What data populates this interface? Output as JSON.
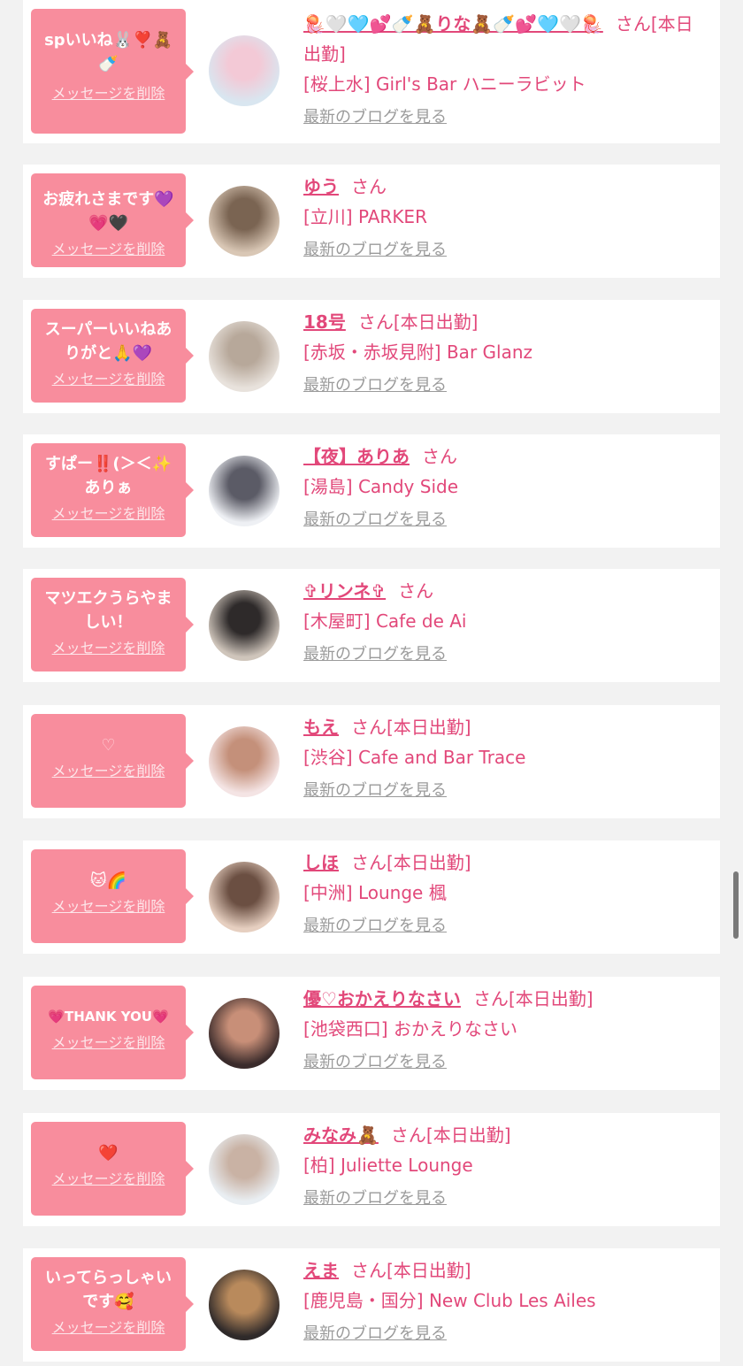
{
  "delete_label": "メッセージを削除",
  "blog_label": "最新のブログを見る",
  "san_label": "さん",
  "colors": {
    "bubble": "#f88d9d",
    "accent": "#e2487a",
    "link_gray": "#9b9b9b",
    "background": "#f2f2f2"
  },
  "items": [
    {
      "message": "spいいね🐰❣️🧸🍼",
      "name": "🪼🤍🩵💕🍼🧸りな🧸🍼💕🩵🤍🪼",
      "today": "[本日出勤]",
      "shop": "[桜上水] Girl's Bar ハニーラビット",
      "avatar_colors": [
        "#d9e6f0",
        "#f3c9d6"
      ]
    },
    {
      "message": "お疲れさまです💜💗🖤",
      "name": "ゆう",
      "today": "",
      "shop": "[立川] PARKER",
      "avatar_colors": [
        "#d9c7b5",
        "#7a6452"
      ]
    },
    {
      "message": "スーパーいいねありがと🙏💜",
      "name": "18号",
      "today": "[本日出勤]",
      "shop": "[赤坂・赤坂見附] Bar Glanz",
      "avatar_colors": [
        "#e8e2dc",
        "#b7a89a"
      ]
    },
    {
      "message": "すぱー‼️(＞＜✨ありぁ",
      "name": "【夜】ありあ",
      "today": "",
      "shop": "[湯島] Candy Side",
      "avatar_colors": [
        "#eef0f4",
        "#5b5b66"
      ]
    },
    {
      "message": "マツエクうらやましい！",
      "name": "✞リンネ✞",
      "today": "",
      "shop": "[木屋町] Cafe de Ai",
      "avatar_colors": [
        "#cfc5bb",
        "#2e2a2a"
      ]
    },
    {
      "message": "♡",
      "name": "もえ",
      "today": "[本日出勤]",
      "shop": "[渋谷] Cafe and Bar Trace",
      "avatar_colors": [
        "#f4e4e4",
        "#c4907a"
      ]
    },
    {
      "message": "🐱🌈",
      "name": "しほ",
      "today": "[本日出勤]",
      "shop": "[中洲] Lounge 楓",
      "avatar_colors": [
        "#e6cfc0",
        "#6b4f42"
      ]
    },
    {
      "message": "💗THANK YOU💗",
      "name": "優♡おかえりなさい",
      "today": "[本日出勤]",
      "shop": "[池袋西口] おかえりなさい",
      "avatar_colors": [
        "#3a2b2b",
        "#c88f78"
      ]
    },
    {
      "message": "❤️",
      "name": "みなみ🧸",
      "today": "[本日出勤]",
      "shop": "[柏] Juliette Lounge",
      "avatar_colors": [
        "#e9eef2",
        "#c9b2a4"
      ]
    },
    {
      "message": "いってらっしゃいです🥰",
      "name": "えま",
      "today": "[本日出勤]",
      "shop": "[鹿児島・国分] New Club Les Ailes",
      "avatar_colors": [
        "#2f2a2a",
        "#b98a5c"
      ]
    }
  ]
}
